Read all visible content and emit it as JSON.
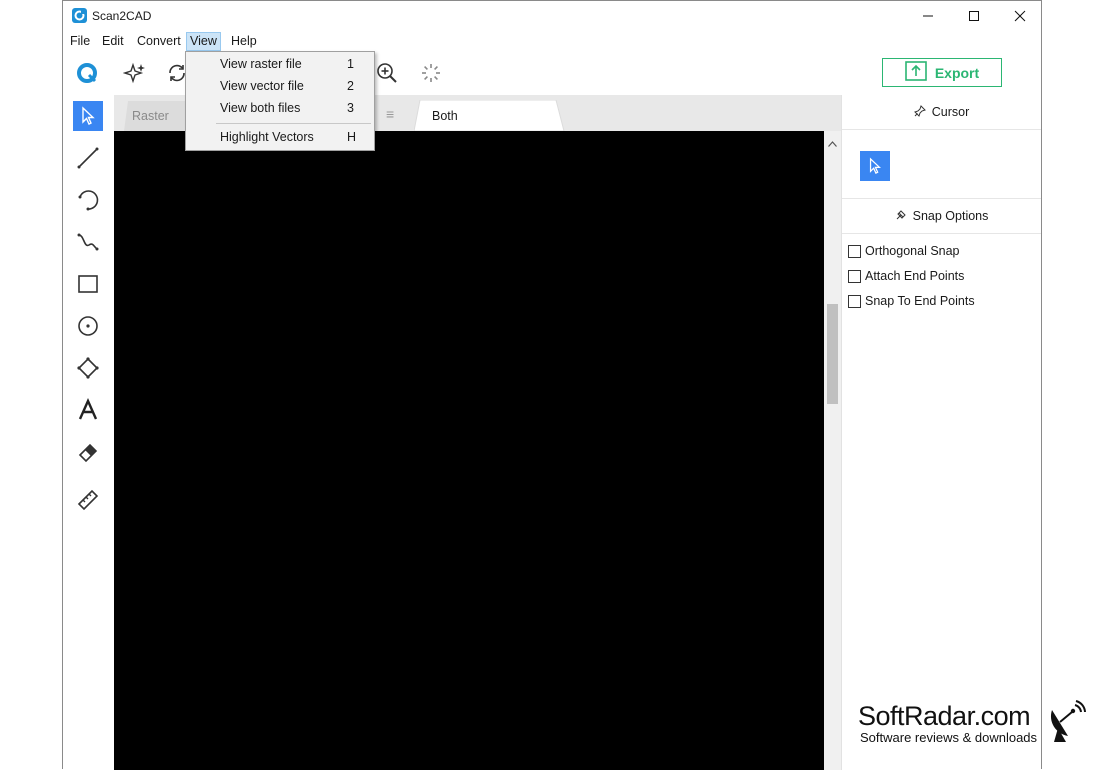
{
  "window": {
    "title": "Scan2CAD"
  },
  "menu": {
    "items": [
      {
        "label": "File"
      },
      {
        "label": "Edit"
      },
      {
        "label": "Convert"
      },
      {
        "label": "View"
      },
      {
        "label": "Help"
      }
    ],
    "active": "View"
  },
  "toolbar": {
    "export_label": "Export"
  },
  "view_dropdown": {
    "items": [
      {
        "label": "View raster file",
        "shortcut": "1"
      },
      {
        "label": "View vector file",
        "shortcut": "2"
      },
      {
        "label": "View both files",
        "shortcut": "3"
      },
      {
        "label": "Highlight Vectors",
        "shortcut": "H"
      }
    ]
  },
  "tabs": [
    {
      "label": "Raster"
    },
    {
      "label": "Both"
    }
  ],
  "right_panel": {
    "cursor_heading": "Cursor",
    "snap_heading": "Snap Options",
    "snap_options": [
      {
        "label": "Orthogonal Snap",
        "checked": false
      },
      {
        "label": "Attach End Points",
        "checked": false
      },
      {
        "label": "Snap To End Points",
        "checked": false
      }
    ]
  },
  "watermark": {
    "title": "SoftRadar.com",
    "subtitle": "Software reviews & downloads"
  },
  "colors": {
    "accent": "#3a86f2",
    "export_green": "#2bb673",
    "canvas": "#000000"
  }
}
